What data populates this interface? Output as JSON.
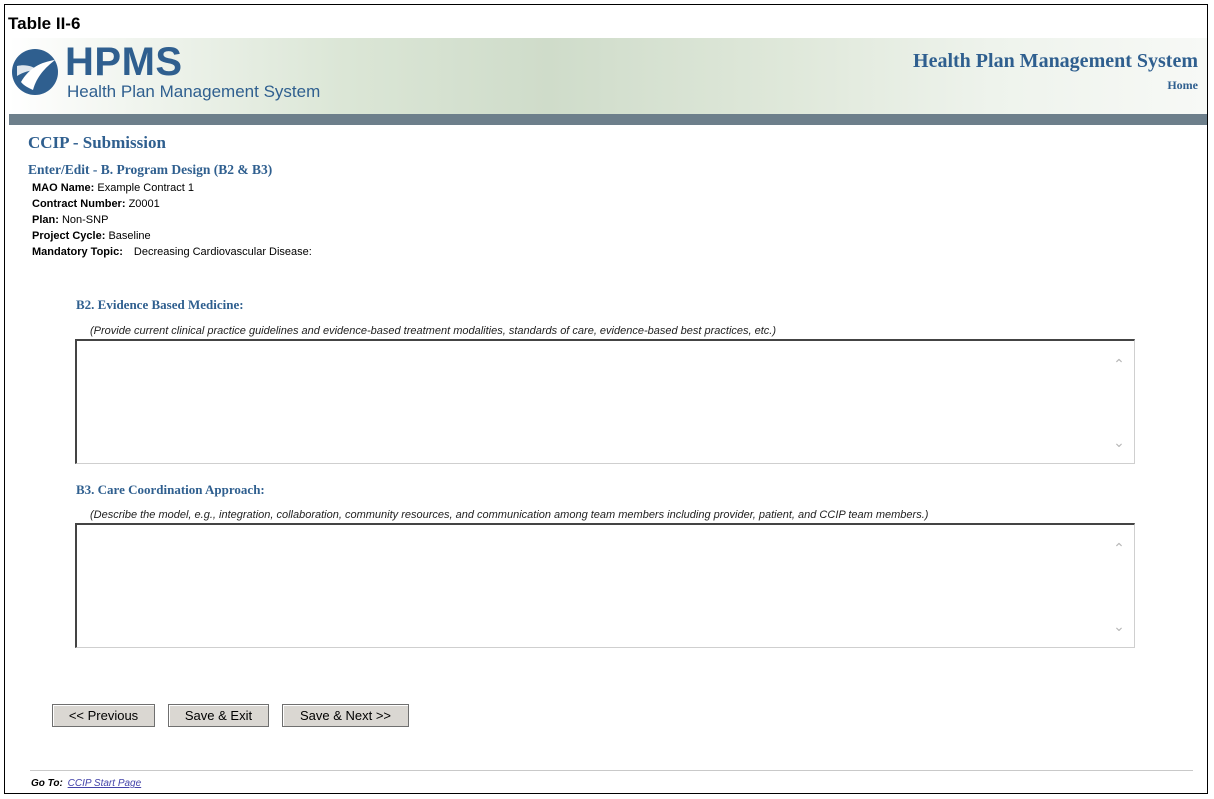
{
  "caption": "Table II-6",
  "header": {
    "logo_text": "HPMS",
    "logo_subtitle": "Health Plan Management System",
    "system_title": "Health Plan Management System",
    "home_link": "Home"
  },
  "page": {
    "title": "CCIP - Submission",
    "subtitle": "Enter/Edit - B. Program Design (B2 & B3)"
  },
  "info": {
    "mao_name_label": "MAO Name:",
    "mao_name_value": "Example Contract 1",
    "contract_number_label": "Contract Number:",
    "contract_number_value": "Z0001",
    "plan_label": "Plan:",
    "plan_value": "Non-SNP",
    "project_cycle_label": "Project Cycle:",
    "project_cycle_value": "Baseline",
    "mandatory_topic_label": "Mandatory Topic:",
    "mandatory_topic_value": "Decreasing Cardiovascular Disease:"
  },
  "sections": {
    "b2": {
      "title": "B2. Evidence Based Medicine:",
      "instruction": "(Provide current clinical practice guidelines and evidence-based treatment modalities, standards of care, evidence-based best practices, etc.)",
      "value": ""
    },
    "b3": {
      "title": "B3. Care Coordination Approach:",
      "instruction": "(Describe the model, e.g., integration, collaboration, community resources, and communication among team members including provider, patient, and CCIP team members.)",
      "value": ""
    }
  },
  "buttons": {
    "previous": "<< Previous",
    "save_exit": "Save & Exit",
    "save_next": "Save & Next >>"
  },
  "footer": {
    "goto_label": "Go To:",
    "goto_link": "CCIP Start Page"
  },
  "colors": {
    "brand_blue": "#2f5f8f",
    "banner_bar": "#6d7f8b"
  },
  "icons": {
    "logo": "hpms-logo-icon",
    "scroll_up": "chevron-up-icon",
    "scroll_down": "chevron-down-icon"
  }
}
